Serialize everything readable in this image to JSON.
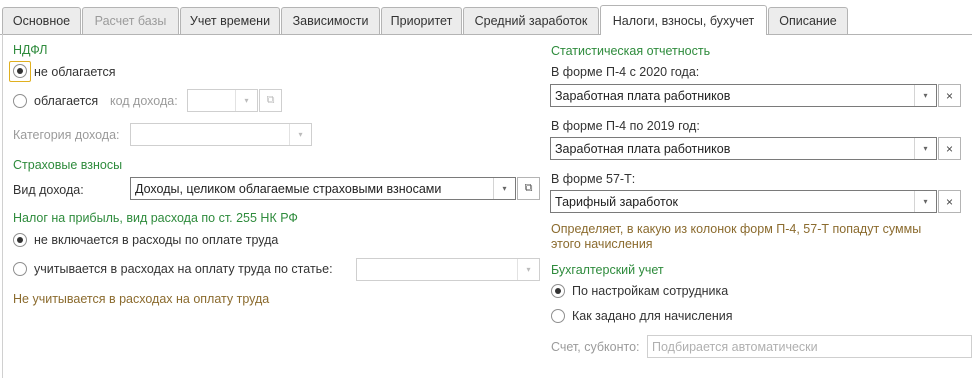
{
  "tabs": [
    {
      "label": "Основное",
      "state": "normal"
    },
    {
      "label": "Расчет базы",
      "state": "disabled"
    },
    {
      "label": "Учет времени",
      "state": "normal"
    },
    {
      "label": "Зависимости",
      "state": "normal"
    },
    {
      "label": "Приоритет",
      "state": "normal"
    },
    {
      "label": "Средний заработок",
      "state": "normal"
    },
    {
      "label": "Налоги, взносы, бухучет",
      "state": "active"
    },
    {
      "label": "Описание",
      "state": "normal"
    }
  ],
  "ndfl": {
    "title": "НДФЛ",
    "opt_not_taxed": "не облагается",
    "opt_taxed": "облагается",
    "income_code_label": "код дохода:",
    "income_category_label": "Категория дохода:",
    "selected": "not_taxed"
  },
  "insurance": {
    "title": "Страховые взносы",
    "income_type_label": "Вид дохода:",
    "income_type_value": "Доходы, целиком облагаемые страховыми взносами"
  },
  "profit_tax": {
    "title": "Налог на прибыль, вид расхода по ст. 255 НК РФ",
    "opt_not_included": "не включается в расходы по оплате труда",
    "opt_included": "учитывается в расходах на оплату труда по статье:",
    "note": "Не учитывается в расходах на оплату труда",
    "selected": "not_included"
  },
  "statistics": {
    "title": "Статистическая отчетность",
    "p4_2020_label": "В форме П-4 с 2020 года:",
    "p4_2020_value": "Заработная плата работников",
    "p4_2019_label": "В форме П-4 по 2019 год:",
    "p4_2019_value": "Заработная плата работников",
    "f57t_label": "В форме 57-Т:",
    "f57t_value": "Тарифный заработок",
    "note_line1": "Определяет, в какую из колонок форм П-4, 57-Т попадут суммы",
    "note_line2": "этого начисления"
  },
  "accounting": {
    "title": "Бухгалтерский учет",
    "opt_by_employee": "По настройкам сотрудника",
    "opt_as_set": "Как задано для начисления",
    "account_label": "Счет, субконто:",
    "account_placeholder": "Подбирается автоматически",
    "selected": "by_employee"
  },
  "icons": {
    "dropdown": "▾",
    "open": "⧉",
    "clear": "×"
  }
}
